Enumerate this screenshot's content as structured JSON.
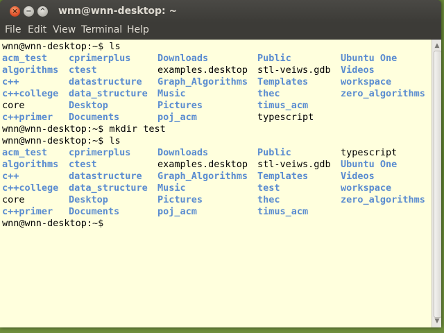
{
  "window": {
    "title": "wnn@wnn-desktop: ~",
    "close_glyph": "×",
    "min_glyph": "−",
    "max_glyph": "^"
  },
  "menubar": {
    "items": [
      "File",
      "Edit",
      "View",
      "Terminal",
      "Help"
    ]
  },
  "colors": {
    "terminal_bg": "#ffffdd",
    "directory_text": "#5a8cd0",
    "file_text": "#000000",
    "titlebar_bg": "#3c3b37"
  },
  "terminal": {
    "lines": [
      {
        "type": "prompt",
        "text": "wnn@wnn-desktop:~$ ls"
      },
      {
        "type": "listing",
        "cells": [
          {
            "text": "acm_test",
            "kind": "dir"
          },
          {
            "text": "cprimerplus",
            "kind": "dir"
          },
          {
            "text": "Downloads",
            "kind": "dir"
          },
          {
            "text": "Public",
            "kind": "dir"
          },
          {
            "text": "Ubuntu One",
            "kind": "dir"
          }
        ]
      },
      {
        "type": "listing",
        "cells": [
          {
            "text": "algorithms",
            "kind": "dir"
          },
          {
            "text": "ctest",
            "kind": "dir"
          },
          {
            "text": "examples.desktop",
            "kind": "file"
          },
          {
            "text": "stl-veiws.gdb",
            "kind": "file"
          },
          {
            "text": "Videos",
            "kind": "dir"
          }
        ]
      },
      {
        "type": "listing",
        "cells": [
          {
            "text": "c++",
            "kind": "dir"
          },
          {
            "text": "datastructure",
            "kind": "dir"
          },
          {
            "text": "Graph_Algorithms",
            "kind": "dir"
          },
          {
            "text": "Templates",
            "kind": "dir"
          },
          {
            "text": "workspace",
            "kind": "dir"
          }
        ]
      },
      {
        "type": "listing",
        "cells": [
          {
            "text": "c++college",
            "kind": "dir"
          },
          {
            "text": "data_structure",
            "kind": "dir"
          },
          {
            "text": "Music",
            "kind": "dir"
          },
          {
            "text": "thec",
            "kind": "dir"
          },
          {
            "text": "zero_algorithms",
            "kind": "dir"
          }
        ]
      },
      {
        "type": "listing",
        "cells": [
          {
            "text": "core",
            "kind": "file"
          },
          {
            "text": "Desktop",
            "kind": "dir"
          },
          {
            "text": "Pictures",
            "kind": "dir"
          },
          {
            "text": "timus_acm",
            "kind": "dir"
          },
          {
            "text": "",
            "kind": "file"
          }
        ]
      },
      {
        "type": "listing",
        "cells": [
          {
            "text": "c++primer",
            "kind": "dir"
          },
          {
            "text": "Documents",
            "kind": "dir"
          },
          {
            "text": "poj_acm",
            "kind": "dir"
          },
          {
            "text": "typescript",
            "kind": "file"
          },
          {
            "text": "",
            "kind": "file"
          }
        ]
      },
      {
        "type": "prompt",
        "text": "wnn@wnn-desktop:~$ mkdir test"
      },
      {
        "type": "prompt",
        "text": "wnn@wnn-desktop:~$ ls"
      },
      {
        "type": "listing",
        "cells": [
          {
            "text": "acm_test",
            "kind": "dir"
          },
          {
            "text": "cprimerplus",
            "kind": "dir"
          },
          {
            "text": "Downloads",
            "kind": "dir"
          },
          {
            "text": "Public",
            "kind": "dir"
          },
          {
            "text": "typescript",
            "kind": "file"
          }
        ]
      },
      {
        "type": "listing",
        "cells": [
          {
            "text": "algorithms",
            "kind": "dir"
          },
          {
            "text": "ctest",
            "kind": "dir"
          },
          {
            "text": "examples.desktop",
            "kind": "file"
          },
          {
            "text": "stl-veiws.gdb",
            "kind": "file"
          },
          {
            "text": "Ubuntu One",
            "kind": "dir"
          }
        ]
      },
      {
        "type": "listing",
        "cells": [
          {
            "text": "c++",
            "kind": "dir"
          },
          {
            "text": "datastructure",
            "kind": "dir"
          },
          {
            "text": "Graph_Algorithms",
            "kind": "dir"
          },
          {
            "text": "Templates",
            "kind": "dir"
          },
          {
            "text": "Videos",
            "kind": "dir"
          }
        ]
      },
      {
        "type": "listing",
        "cells": [
          {
            "text": "c++college",
            "kind": "dir"
          },
          {
            "text": "data_structure",
            "kind": "dir"
          },
          {
            "text": "Music",
            "kind": "dir"
          },
          {
            "text": "test",
            "kind": "dir"
          },
          {
            "text": "workspace",
            "kind": "dir"
          }
        ]
      },
      {
        "type": "listing",
        "cells": [
          {
            "text": "core",
            "kind": "file"
          },
          {
            "text": "Desktop",
            "kind": "dir"
          },
          {
            "text": "Pictures",
            "kind": "dir"
          },
          {
            "text": "thec",
            "kind": "dir"
          },
          {
            "text": "zero_algorithms",
            "kind": "dir"
          }
        ]
      },
      {
        "type": "listing",
        "cells": [
          {
            "text": "c++primer",
            "kind": "dir"
          },
          {
            "text": "Documents",
            "kind": "dir"
          },
          {
            "text": "poj_acm",
            "kind": "dir"
          },
          {
            "text": "timus_acm",
            "kind": "dir"
          },
          {
            "text": "",
            "kind": "file"
          }
        ]
      },
      {
        "type": "prompt",
        "text": "wnn@wnn-desktop:~$"
      }
    ]
  }
}
